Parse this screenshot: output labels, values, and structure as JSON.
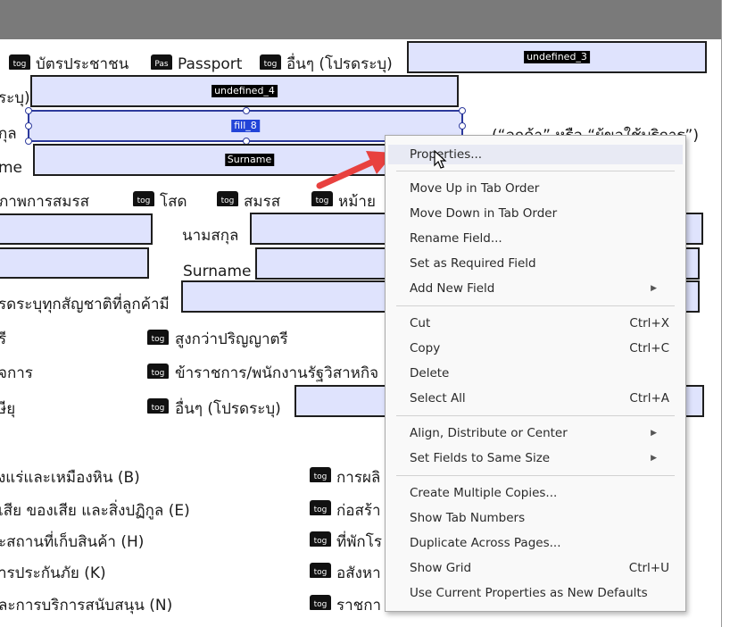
{
  "toggle_label": "tog",
  "pas_label": "Pas",
  "doc": {
    "id_card": "บัตรประชาชน",
    "passport": "Passport",
    "other_specify": "อื่นๆ (โปรดระบุ)",
    "specify_partial": "ระบุ)",
    "kul_partial": "กุล",
    "me_partial": "me",
    "marital_status": "ภาพการสมรส",
    "single": "โสด",
    "married": "สมรส",
    "widowed": "หม้าย",
    "lastname_th": "นามสกุล",
    "surname": "Surname",
    "nationality_note": "รดระบุทุกสัญชาติที่ลูกค้ามี",
    "degree_partial": "รี",
    "above_bachelor": "สูงกว่าปริญญาตรี",
    "business_partial": "จการ",
    "gov_employee": "ข้าราชการ/พนักงานรัฐวิสาหกิจ",
    "retired_partial": "ษียุ",
    "other_specify2": "อื่นๆ (โปรดระบุ)",
    "customer_quote": "(“ลูกค้า” หรือ “ผู้ขอใช้บริการ”)",
    "mining": "งแร่และเหมืองหิน (B)",
    "waste": "เสีย ของเสีย และสิ่งปฏิกูล (E)",
    "warehouse": "ะสถานที่เก็บสินค้า (H)",
    "insurance": "ารประกันภัย (K)",
    "support": "ละการบริการสนับสนุน (N)",
    "col2_1": "การผลิ",
    "col2_2": "ก่อสร้า",
    "col2_3": "ที่พักโร",
    "col2_4": "อสังหา",
    "col2_5": "ราชกา"
  },
  "fields": {
    "undefined_3": "undefined_3",
    "undefined_4": "undefined_4",
    "fill_8": "fill_8",
    "surname": "Surname"
  },
  "context_menu": {
    "properties": "Properties...",
    "move_up": "Move Up in Tab Order",
    "move_down": "Move Down in Tab Order",
    "rename": "Rename Field...",
    "required": "Set as Required Field",
    "add_new": "Add New Field",
    "cut": "Cut",
    "cut_sc": "Ctrl+X",
    "copy": "Copy",
    "copy_sc": "Ctrl+C",
    "delete": "Delete",
    "select_all": "Select All",
    "select_all_sc": "Ctrl+A",
    "align": "Align, Distribute or Center",
    "same_size": "Set Fields to Same Size",
    "multiple": "Create Multiple Copies...",
    "tab_numbers": "Show Tab Numbers",
    "duplicate": "Duplicate Across Pages...",
    "grid": "Show Grid",
    "grid_sc": "Ctrl+U",
    "defaults": "Use Current Properties as New Defaults"
  },
  "colors": {
    "field_fill": "#dfe3fd",
    "annotation_arrow": "#e8413f",
    "menu_hover": "#e8eaf4"
  }
}
